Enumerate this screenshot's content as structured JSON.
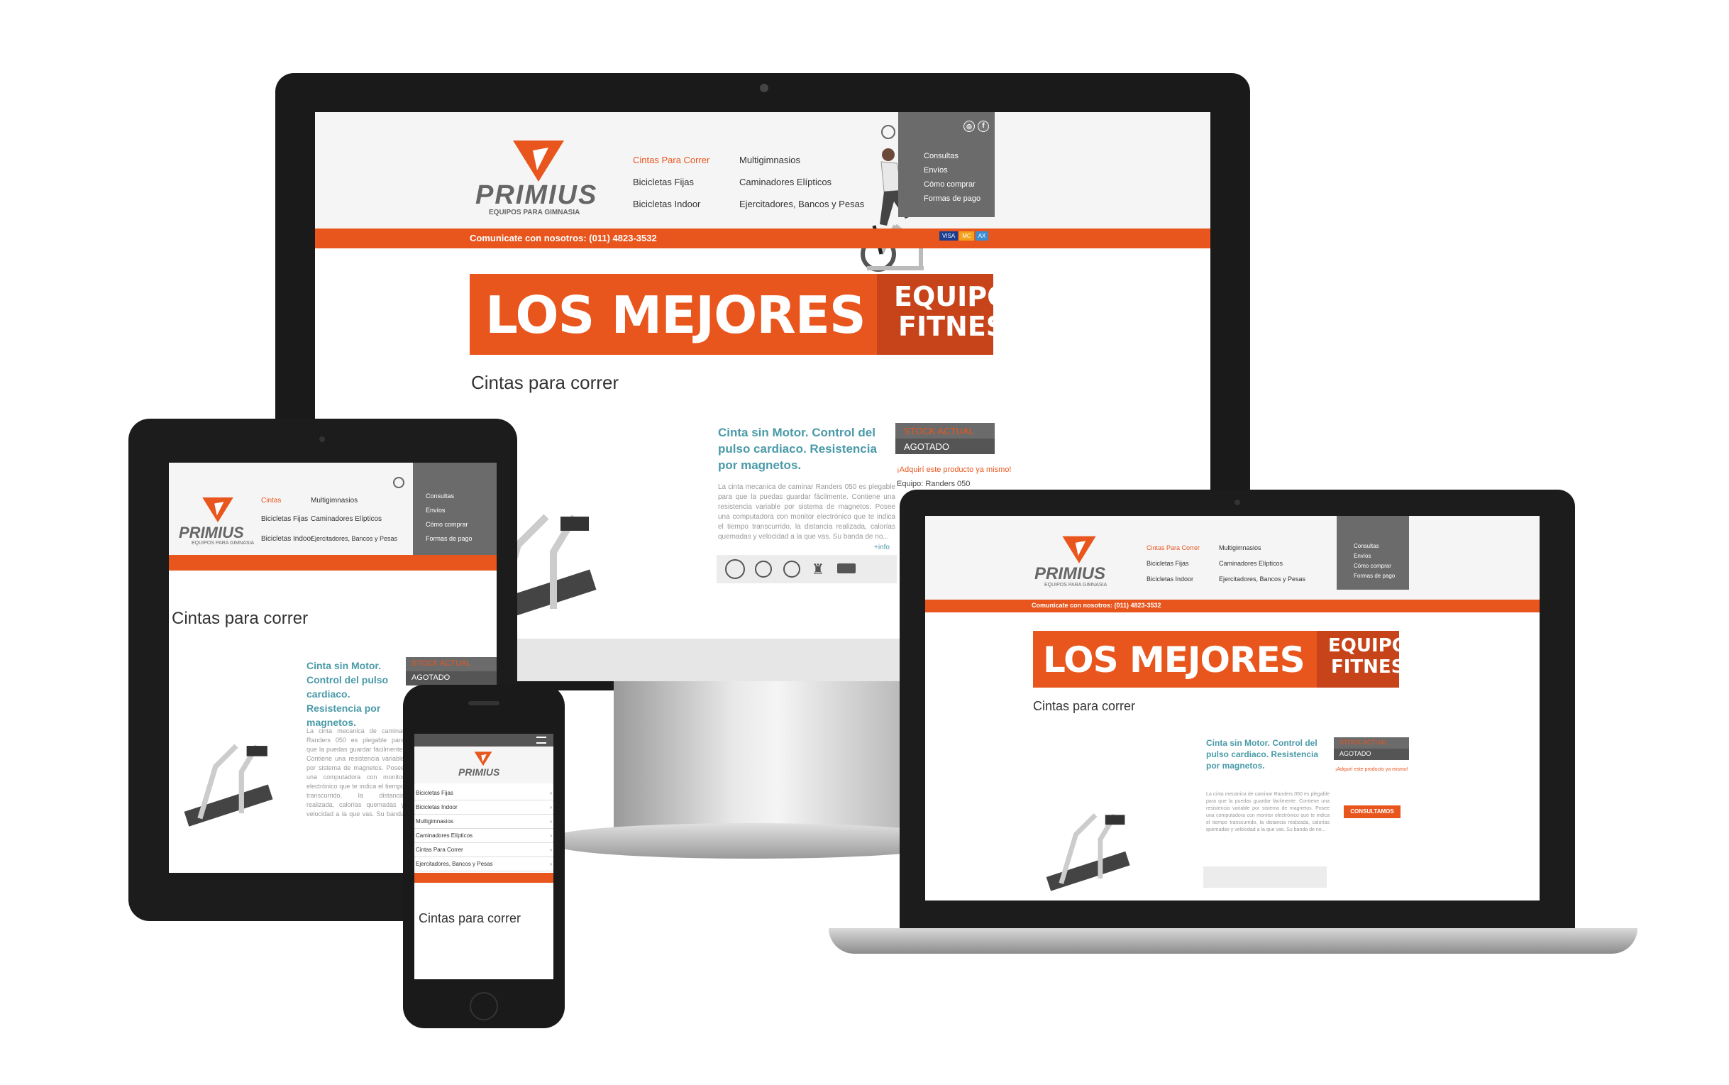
{
  "brand": {
    "name": "PRIMIUS",
    "tagline": "EQUIPOS PARA GIMNASIA",
    "orange": "#e8561e",
    "dark_orange": "#c7441a",
    "teal": "#4a9aa8",
    "panel_gray": "#6b6b6b"
  },
  "nav": {
    "col1": [
      "Cintas Para Correr",
      "Bicicletas Fijas",
      "Bicicletas Indoor"
    ],
    "col2": [
      "Multigimnasios",
      "Caminadores Elípticos",
      "Ejercitadores, Bancos y Pesas"
    ],
    "panel": [
      "Consultas",
      "Envíos",
      "Cómo comprar",
      "Formas de pago"
    ]
  },
  "tablet_nav": {
    "col1": [
      "Cintas",
      "Bicicletas Fijas",
      "Bicicletas Indoor"
    ],
    "col2": [
      "Multigimnasios",
      "Caminadores Elípticos",
      "Ejercitadores, Bancos y Pesas"
    ]
  },
  "contact": "Comunicate con nosotros: (011) 4823-3532",
  "banner": {
    "left": "LOS MEJORES",
    "right_top": "EQUIPOS",
    "right_bottom": "FITNESS"
  },
  "page_title": "Cintas para correr",
  "product": {
    "title": "Cinta sin Motor. Control del pulso cardiaco. Resistencia por magnetos.",
    "description": "La cinta mecanica de caminar Randers 050 es plegable para que la puedas guardar fácilmente. Contiene una resistencia variable por sistema de magnetos. Posee una computadora con monitor electrónico que te indica el tiempo transcurrido, la distancia realizada, calorías quemadas y velocidad a la que vas. Su banda de no...",
    "more": "+info",
    "stock_label": "STOCK ACTUAL",
    "stock_value": "AGOTADO",
    "acquire": "¡Adquirí este producto ya mismo!",
    "equipment": "Equipo: Randers 050",
    "cta": "CONSULTAMOS"
  },
  "mobile_nav": [
    "Bicicletas Fijas",
    "Bicicletas Indoor",
    "Multigimnasios",
    "Caminadores Elípticos",
    "Cintas Para Correr",
    "Ejercitadores, Bancos y Pesas"
  ],
  "icons": [
    "search-icon",
    "instagram-icon",
    "facebook-icon",
    "gear-icon",
    "warranty-icon",
    "service-icon",
    "hand-truck-icon",
    "delivery-truck-icon",
    "menu-icon"
  ],
  "payment_cards": [
    "VISA",
    "MC",
    "AMEX"
  ]
}
